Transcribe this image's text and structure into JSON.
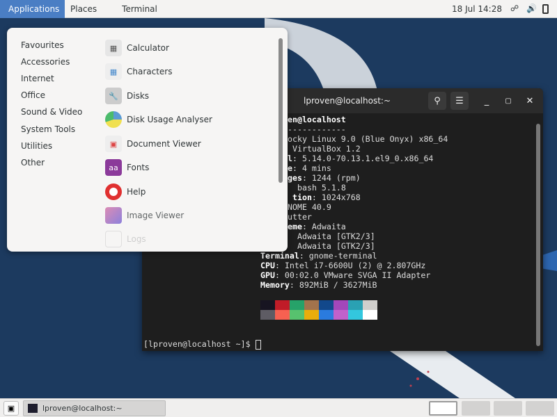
{
  "topbar": {
    "applications": "Applications",
    "places": "Places",
    "terminal": "Terminal",
    "clock": "18 Jul  14:28"
  },
  "menu": {
    "categories": [
      "Favourites",
      "Accessories",
      "Internet",
      "Office",
      "Sound & Video",
      "System Tools",
      "Utilities",
      "Other"
    ],
    "apps": [
      {
        "label": "Calculator",
        "icon": "calculator-icon"
      },
      {
        "label": "Characters",
        "icon": "characters-icon"
      },
      {
        "label": "Disks",
        "icon": "disks-icon"
      },
      {
        "label": "Disk Usage Analyser",
        "icon": "pie-chart-icon"
      },
      {
        "label": "Document Viewer",
        "icon": "document-viewer-icon"
      },
      {
        "label": "Fonts",
        "icon": "fonts-icon"
      },
      {
        "label": "Help",
        "icon": "lifebuoy-icon"
      },
      {
        "label": "Image Viewer",
        "icon": "image-viewer-icon"
      },
      {
        "label": "Logs",
        "icon": "logs-icon"
      }
    ]
  },
  "terminal": {
    "title": "lproven@localhost:~",
    "lines": [
      {
        "key": "en@localhost",
        "value": ""
      },
      {
        "key": "",
        "value": "------------"
      },
      {
        "key": "",
        "value": "ocky Linux 9.0 (Blue Onyx) x86_64"
      },
      {
        "key": "",
        "value": "VirtualBox 1.2"
      },
      {
        "key": "l",
        "value": ": 5.14.0-70.13.1.el9_0.x86_64"
      },
      {
        "key": "e",
        "value": ": 4 mins"
      },
      {
        "key": "ges",
        "value": ": 1244 (rpm)"
      },
      {
        "key": "",
        "value": "bash 5.1.8"
      },
      {
        "key": "tion",
        "value": ": 1024x768"
      },
      {
        "key": "",
        "value": "NOME 40.9"
      },
      {
        "key": "",
        "value": "utter"
      },
      {
        "key": "eme",
        "value": ": Adwaita"
      },
      {
        "key": "",
        "value": "Adwaita [GTK2/3]"
      },
      {
        "key": "",
        "value": "Adwaita [GTK2/3]"
      },
      {
        "key": "Terminal",
        "value": ": gnome-terminal"
      },
      {
        "key": "CPU",
        "value": ": Intel i7-6600U (2) @ 2.807GHz"
      },
      {
        "key": "GPU",
        "value": ": 00:02.0 VMware SVGA II Adapter"
      },
      {
        "key": "Memory",
        "value": ": 892MiB / 3627MiB"
      }
    ],
    "palette": [
      "#171421",
      "#c01c28",
      "#26a269",
      "#a2734c",
      "#12488b",
      "#a347ba",
      "#2aa1b3",
      "#d0cfcc",
      "#5e5c64",
      "#f66151",
      "#57c26e",
      "#e9ad0c",
      "#2a7bde",
      "#c061cb",
      "#33c7de",
      "#ffffff"
    ],
    "prompt": "[lproven@localhost ~]$ "
  },
  "taskbar": {
    "window": "lproven@localhost:~",
    "workspaces": 4,
    "active_workspace": 1
  },
  "colors": {
    "accent": "#4a7ec4",
    "desktop": "#1c3a5f"
  }
}
